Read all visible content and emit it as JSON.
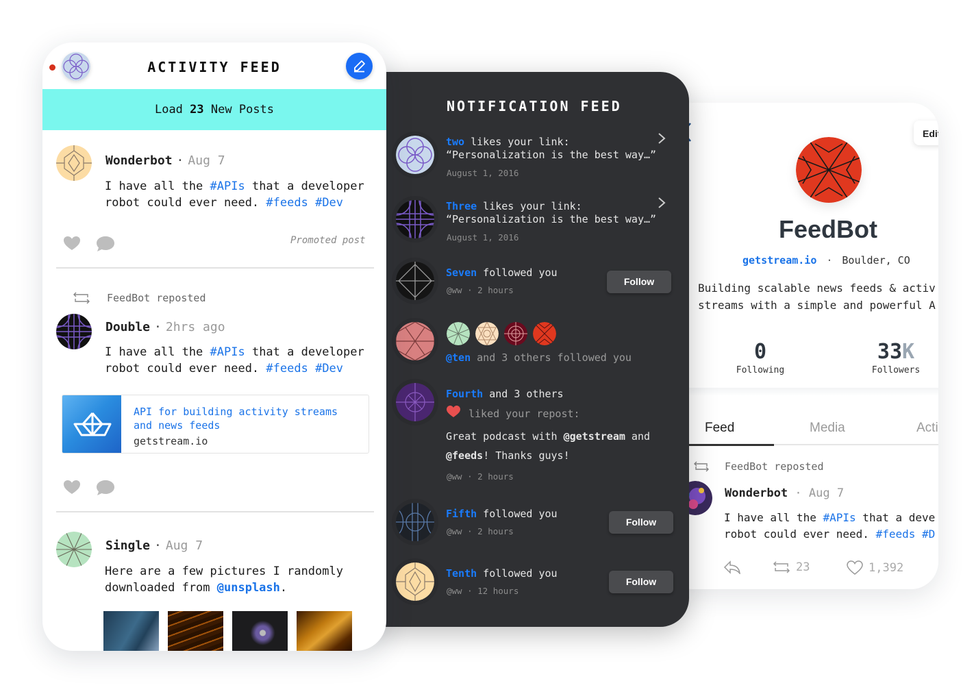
{
  "activity_feed": {
    "title": "ACTIVITY FEED",
    "banner": {
      "prefix": "Load",
      "count": "23",
      "suffix": "New Posts"
    },
    "posts": [
      {
        "author": "Wonderbot",
        "date": "Aug 7",
        "body_line1_pre": "I have all the ",
        "body_line1_tag": "#APIs",
        "body_line1_post": " that a developer",
        "body_line2_pre": "robot could ever need. ",
        "body_line2_tag1": "#feeds",
        "body_line2_tag2": "#Dev",
        "promoted_label": "Promoted post"
      },
      {
        "repost_label": "FeedBot reposted",
        "author": "Double",
        "date": "2hrs ago",
        "body_line1_pre": "I have all the ",
        "body_line1_tag": "#APIs",
        "body_line1_post": " that a developer",
        "body_line2_pre": "robot could ever need. ",
        "body_line2_tag1": "#feeds",
        "body_line2_tag2": "#Dev",
        "link_card": {
          "title_line1": "API for building activity streams",
          "title_line2": "and news feeds",
          "domain": "getstream.io"
        }
      },
      {
        "author": "Single",
        "date": "Aug 7",
        "body_line1": "Here are a few pictures I randomly",
        "body_line2_pre": "downloaded from ",
        "body_line2_mention": "@unsplash",
        "body_line2_post": ".",
        "photo_count": 4
      }
    ]
  },
  "notification_feed": {
    "title": "NOTIFICATION FEED",
    "items": [
      {
        "who": "two",
        "text": " likes your link:",
        "quote": "“Personalization is the best way…”",
        "sub": "August 1, 2016"
      },
      {
        "who": "Three",
        "text": " likes your link:",
        "quote": "“Personalization is the best way…”",
        "sub": "August 1, 2016"
      },
      {
        "who": "Seven",
        "text": " followed you",
        "sub": "@ww · 2 hours",
        "button": "Follow"
      },
      {
        "who": "@ten",
        "text": " and 3 others followed you"
      },
      {
        "who": "Fourth",
        "text": " and 3 others",
        "action": "liked your repost:",
        "quote_line1_pre": "Great podcast with ",
        "quote_line1_mention": "@getstream",
        "quote_line1_post": " and",
        "quote_line2_mention": "@feeds",
        "quote_line2_post": "! Thanks guys!",
        "sub": "@ww · 2 hours"
      },
      {
        "who": "Fifth",
        "text": " followed you",
        "sub": "@ww · 2 hours",
        "button": "Follow"
      },
      {
        "who": "Tenth",
        "text": " followed you",
        "sub": "@ww · 12 hours",
        "button": "Follow"
      }
    ]
  },
  "profile": {
    "edit_label": "Edit",
    "name": "FeedBot",
    "link": "getstream.io",
    "location": "Boulder, CO",
    "bio_line1": "Building scalable news feeds & activ",
    "bio_line2": "streams with a simple and powerful A",
    "following_count": "0",
    "following_label": "Following",
    "followers_num": "33",
    "followers_suffix": "K",
    "followers_label": "Followers",
    "tabs": [
      "Feed",
      "Media",
      "Acti"
    ],
    "active_tab": "Feed",
    "post": {
      "repost_label": "FeedBot reposted",
      "author": "Wonderbot",
      "date": "Aug 7",
      "body_line1_pre": "I have all the ",
      "body_line1_tag": "#APIs",
      "body_line1_post": " that a deve",
      "body_line2_pre": "robot could ever need. ",
      "body_line2_tag1": "#feeds",
      "body_line2_tag2": "#D",
      "repost_count": "23",
      "like_count": "1,392"
    }
  },
  "colors": {
    "accent_blue": "#1a73e8",
    "banner_cyan": "#7af7ee",
    "dark_panel": "#2f3033",
    "feedbot_red": "#e0381f"
  }
}
